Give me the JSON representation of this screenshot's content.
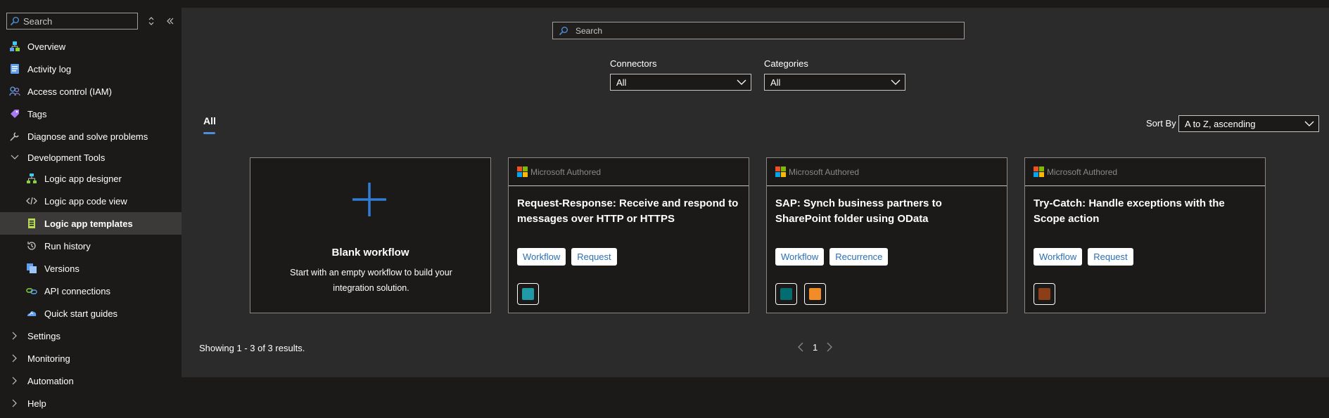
{
  "sidebar": {
    "search_placeholder": "Search",
    "items": [
      {
        "label": "Overview",
        "icon": "overview-icon"
      },
      {
        "label": "Activity log",
        "icon": "activity-log-icon"
      },
      {
        "label": "Access control (IAM)",
        "icon": "access-control-icon"
      },
      {
        "label": "Tags",
        "icon": "tags-icon"
      },
      {
        "label": "Diagnose and solve problems",
        "icon": "wrench-icon"
      },
      {
        "label": "Development Tools",
        "icon": "chevron-down-icon"
      },
      {
        "label": "Logic app designer",
        "icon": "designer-icon"
      },
      {
        "label": "Logic app code view",
        "icon": "code-icon"
      },
      {
        "label": "Logic app templates",
        "icon": "templates-icon"
      },
      {
        "label": "Run history",
        "icon": "history-icon"
      },
      {
        "label": "Versions",
        "icon": "versions-icon"
      },
      {
        "label": "API connections",
        "icon": "api-connections-icon"
      },
      {
        "label": "Quick start guides",
        "icon": "quick-start-icon"
      },
      {
        "label": "Settings",
        "icon": "chevron-right-icon"
      },
      {
        "label": "Monitoring",
        "icon": "chevron-right-icon"
      },
      {
        "label": "Automation",
        "icon": "chevron-right-icon"
      },
      {
        "label": "Help",
        "icon": "chevron-right-icon"
      }
    ]
  },
  "main": {
    "search_placeholder": "Search",
    "connectors_label": "Connectors",
    "connectors_value": "All",
    "categories_label": "Categories",
    "categories_value": "All",
    "tab_all": "All",
    "sort_label": "Sort By",
    "sort_value": "A to Z, ascending",
    "blank_card": {
      "title": "Blank workflow",
      "description": "Start with an empty workflow to build your integration solution."
    },
    "cards": [
      {
        "badge": "Microsoft Authored",
        "title": "Request-Response: Receive and respond to messages over HTTP or HTTPS",
        "tags": [
          "Workflow",
          "Request"
        ],
        "connectors": [
          {
            "icon": "http-request-icon",
            "color": "#1f9aa6"
          }
        ]
      },
      {
        "badge": "Microsoft Authored",
        "title": "SAP: Synch business partners to SharePoint folder using OData",
        "tags": [
          "Workflow",
          "Recurrence"
        ],
        "connectors": [
          {
            "icon": "sharepoint-icon",
            "color": "#036c70"
          },
          {
            "icon": "recurrence-icon",
            "color": "#f28c28"
          }
        ]
      },
      {
        "badge": "Microsoft Authored",
        "title": "Try-Catch: Handle exceptions with the Scope action",
        "tags": [
          "Workflow",
          "Request"
        ],
        "connectors": [
          {
            "icon": "scope-icon",
            "color": "#8c3f16"
          }
        ]
      }
    ],
    "results_text": "Showing 1 - 3 of 3 results.",
    "page_number": "1"
  }
}
